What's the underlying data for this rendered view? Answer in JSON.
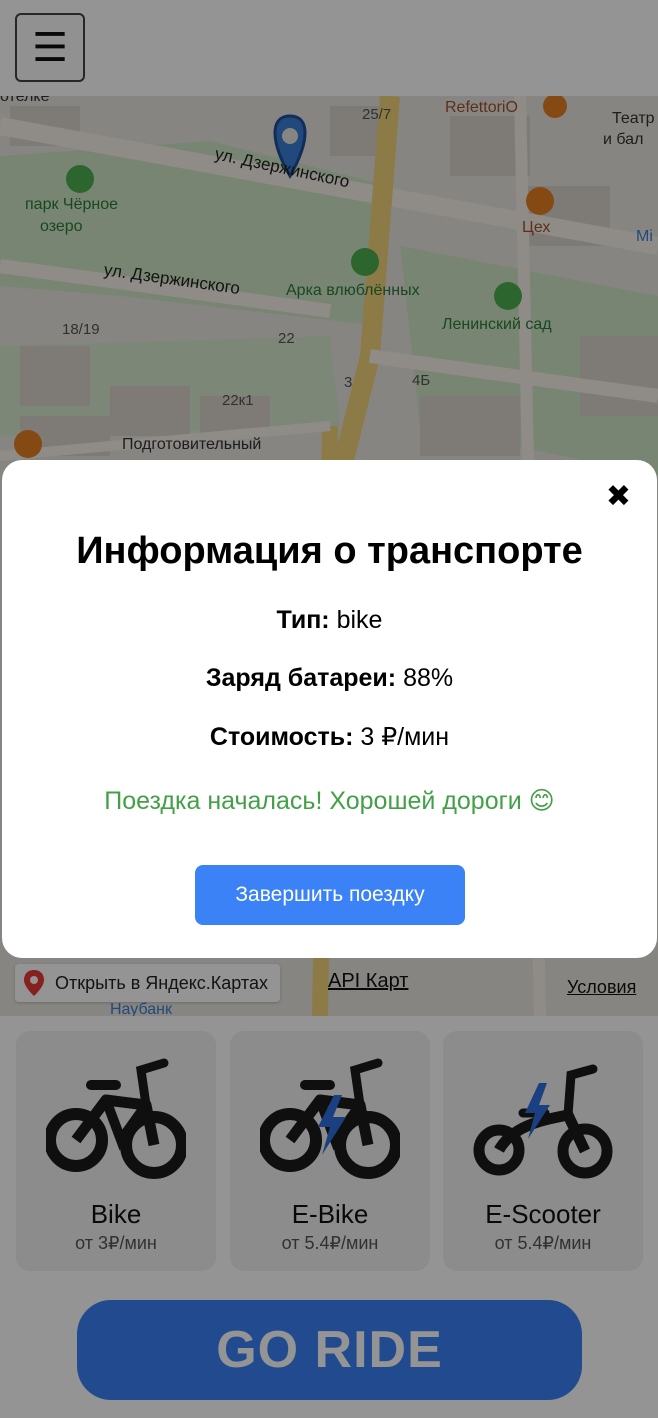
{
  "header": {
    "menu_icon": "hamburger-icon",
    "menu_glyph": "☰"
  },
  "map": {
    "labels": {
      "hotel": "отелке",
      "street_house": "25/7",
      "cafe": "RefettoriO",
      "theatre1": "Театр о",
      "theatre2": "и бал",
      "street1": "ул. Дзержинского",
      "park1": "парк Чёрное",
      "park2": "озеро",
      "tseh": "Цех",
      "street2": "ул. Дзержинского",
      "arka": "Арка влюблённых",
      "leninsky": "Ленинский сад",
      "n1819": "18/19",
      "n22": "22",
      "n3": "3",
      "n4b": "4Б",
      "n22k1": "22к1",
      "podgot": "Подготовительный",
      "mi": "Mi",
      "nauban": "Наубанк"
    },
    "yandex_link": "Открыть в Яндекс.Картах",
    "api_link": "API Карт",
    "terms_link": "Условия"
  },
  "vehicles": [
    {
      "name": "Bike",
      "price": "от 3₽/мин",
      "icon": "bike-icon"
    },
    {
      "name": "E-Bike",
      "price": "от 5.4₽/мин",
      "icon": "ebike-icon"
    },
    {
      "name": "E-Scooter",
      "price": "от 5.4₽/мин",
      "icon": "escooter-icon"
    }
  ],
  "go_ride": "GO RIDE",
  "modal": {
    "close_glyph": "✖",
    "title": "Информация о транспорте",
    "type_label": "Тип:",
    "type_value": "bike",
    "battery_label": "Заряд батареи:",
    "battery_value": "88%",
    "cost_label": "Стоимость:",
    "cost_value": "3 ₽/мин",
    "status": "Поездка началась! Хорошей дороги 😊",
    "finish_button": "Завершить поездку"
  },
  "colors": {
    "accent": "#3b82f6",
    "status_green": "#43a047",
    "overlay": "rgba(0,0,0,0.42)"
  }
}
